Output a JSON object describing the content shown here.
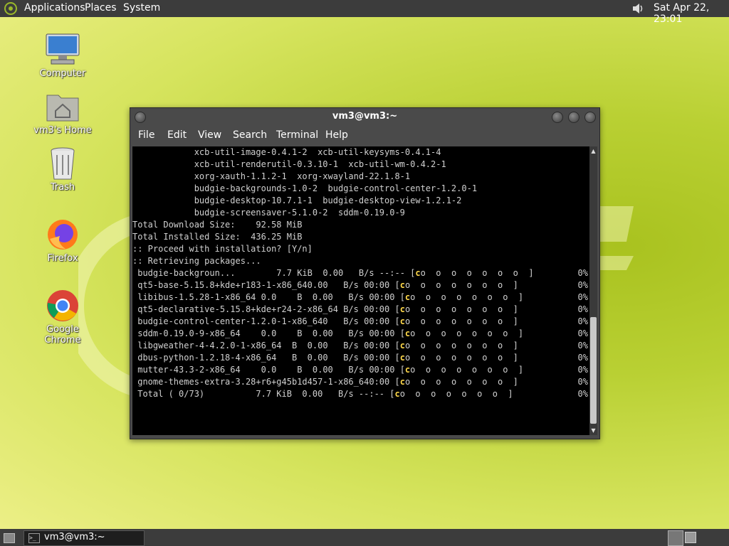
{
  "top_panel": {
    "menus": [
      "Applications",
      "Places",
      "System"
    ],
    "clock": "Sat Apr 22, 23:01"
  },
  "desktop": {
    "icons": [
      {
        "label": "Computer",
        "icon": "computer-icon"
      },
      {
        "label": "vm3's Home",
        "icon": "home-folder-icon"
      },
      {
        "label": "Trash",
        "icon": "trash-icon"
      },
      {
        "label": "Firefox",
        "icon": "firefox-icon"
      },
      {
        "label": "Google Chrome",
        "icon": "chrome-icon"
      }
    ]
  },
  "terminal": {
    "title": "vm3@vm3:~",
    "menu": [
      "File",
      "Edit",
      "View",
      "Search",
      "Terminal",
      "Help"
    ],
    "lines": [
      "            xcb-util-image-0.4.1-2  xcb-util-keysyms-0.4.1-4",
      "            xcb-util-renderutil-0.3.10-1  xcb-util-wm-0.4.2-1",
      "            xorg-xauth-1.1.2-1  xorg-xwayland-22.1.8-1",
      "            budgie-backgrounds-1.0-2  budgie-control-center-1.2.0-1",
      "            budgie-desktop-10.7.1-1  budgie-desktop-view-1.2.1-2",
      "            budgie-screensaver-5.1.0-2  sddm-0.19.0-9",
      "",
      "Total Download Size:    92.58 MiB",
      "Total Installed Size:  436.25 MiB",
      "",
      ":: Proceed with installation? [Y/n]",
      ":: Retrieving packages..."
    ],
    "progress_rows": [
      {
        "name": " budgie-backgroun...",
        "stats": "        7.7 KiB  0.00   B/s --:-- ",
        "pct": "0%"
      },
      {
        "name": " qt5-base-5.15.8+kde+r183-1-x86_64",
        "stats": "0.00   B/s 00:00 ",
        "pct": "0%"
      },
      {
        "name": " libibus-1.5.28-1-x86_64",
        "stats": " 0.0    B  0.00   B/s 00:00 ",
        "pct": "0%"
      },
      {
        "name": " qt5-declarative-5.15.8+kde+r24-2-x86_64",
        "stats": " B/s 00:00 ",
        "pct": "0%"
      },
      {
        "name": " budgie-control-center-1.2.0-1-x86_640",
        "stats": "   B/s 00:00 ",
        "pct": "0%"
      },
      {
        "name": " sddm-0.19.0-9-x86_64",
        "stats": "    0.0    B  0.00   B/s 00:00 ",
        "pct": "0%"
      },
      {
        "name": " libgweather-4-4.2.0-1-x86_64",
        "stats": "  B  0.00   B/s 00:00 ",
        "pct": "0%"
      },
      {
        "name": " dbus-python-1.2.18-4-x86_64",
        "stats": "   B  0.00   B/s 00:00 ",
        "pct": "0%"
      },
      {
        "name": " mutter-43.3-2-x86_64",
        "stats": "    0.0    B  0.00   B/s 00:00 ",
        "pct": "0%"
      },
      {
        "name": " gnome-themes-extra-3.28+r6+g45b1d457-1-x86_640",
        "stats": ":00 ",
        "pct": "0%"
      },
      {
        "name": " Total ( 0/73)",
        "stats": "          7.7 KiB  0.00   B/s --:-- ",
        "pct": "0%"
      }
    ],
    "bar_dots": "o  o  o  o  o  o  o  ]",
    "bar_open": "[",
    "bar_head": "c"
  },
  "taskbar": {
    "task_label": "vm3@vm3:~"
  }
}
